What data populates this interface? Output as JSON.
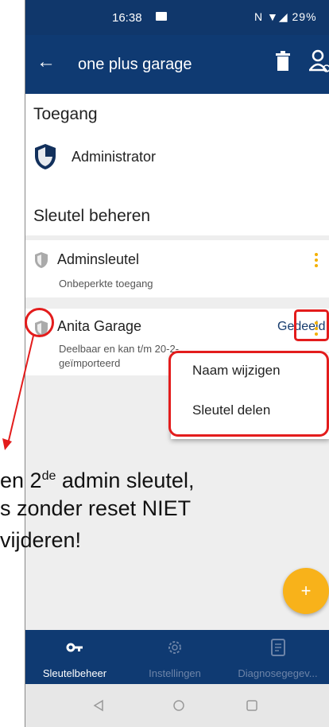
{
  "status_bar": {
    "time": "16:38",
    "right": "N ▼◢ 29%"
  },
  "app_bar": {
    "title": "one plus garage"
  },
  "access": {
    "heading": "Toegang",
    "role": "Administrator"
  },
  "keys": {
    "heading": "Sleutel beheren",
    "items": [
      {
        "name": "Adminsleutel",
        "subtitle": "Onbeperkte toegang",
        "badge": ""
      },
      {
        "name": "Anita Garage",
        "subtitle_line1": "Deelbaar en kan t/m 20-2-",
        "subtitle_line2": "geïmporteerd",
        "badge": "Gedeeld"
      }
    ]
  },
  "popup_menu": {
    "items": [
      "Naam wijzigen",
      "Sleutel delen"
    ]
  },
  "annotation": {
    "line1_pre": "en 2",
    "line1_sup": "de",
    "line1_post": " admin sleutel,",
    "line2": "s zonder reset NIET",
    "line3": "vijderen!"
  },
  "fab": {
    "label": "+"
  },
  "bottom_nav": {
    "items": [
      {
        "label": "Sleutelbeheer",
        "icon": "key-icon",
        "active": true
      },
      {
        "label": "Instellingen",
        "icon": "gear-icon",
        "active": false
      },
      {
        "label": "Diagnosegegev...",
        "icon": "report-icon",
        "active": false
      }
    ]
  },
  "colors": {
    "primary": "#0f3a72",
    "accent": "#f8b21a",
    "highlight": "#e31c1c"
  }
}
